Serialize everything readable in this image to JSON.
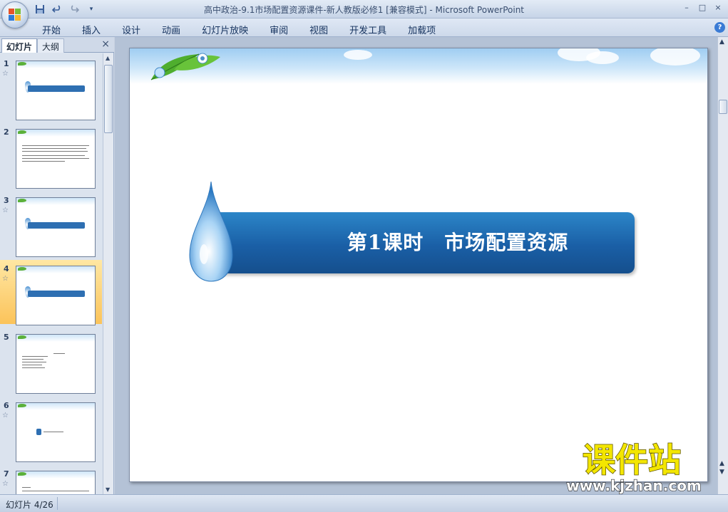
{
  "window": {
    "title": "高中政治-9.1市场配置资源课件-新人教版必修1 [兼容模式] - Microsoft PowerPoint",
    "controls": [
      "–",
      "□",
      "×"
    ]
  },
  "qat": {
    "save_icon": "save-icon",
    "undo_icon": "undo-icon",
    "redo_icon": "redo-icon"
  },
  "ribbon": {
    "tabs": [
      "开始",
      "插入",
      "设计",
      "动画",
      "幻灯片放映",
      "审阅",
      "视图",
      "开发工具",
      "加载项"
    ],
    "help_label": "?"
  },
  "left_panel": {
    "tab_slides": "幻灯片",
    "tab_outline": "大纲",
    "close_label": "×",
    "slides": [
      {
        "num": "1",
        "selected": false
      },
      {
        "num": "2",
        "selected": false
      },
      {
        "num": "3",
        "selected": false
      },
      {
        "num": "4",
        "selected": true
      },
      {
        "num": "5",
        "selected": false
      },
      {
        "num": "6",
        "selected": false
      },
      {
        "num": "7",
        "selected": false
      }
    ]
  },
  "slide": {
    "title": "第1课时　市场配置资源"
  },
  "status": {
    "slide_counter": "幻灯片 4/26"
  },
  "watermark": {
    "text_cn": "课件站",
    "url": "www.kjzhan.com"
  },
  "colors": {
    "banner": "#1a5fa6",
    "watermark_cn": "#f3e600",
    "selected_thumb": "#fbc35a"
  }
}
